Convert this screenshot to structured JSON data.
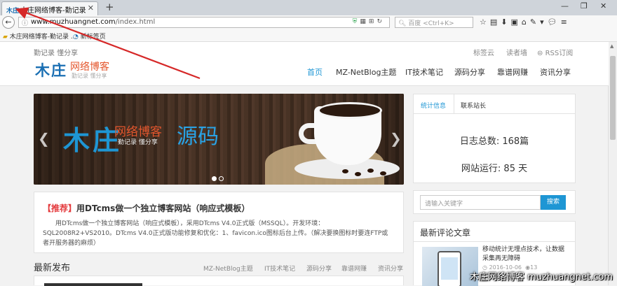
{
  "browser": {
    "tab_title": "木庄网络博客-勤记录 懂分享",
    "tab_favicon_text": "木庄",
    "url_host": "www.muzhuangnet.com",
    "url_path": "/index.html",
    "search_placeholder": "百度 <Ctrl+K>",
    "bookmarks": [
      "木庄网络博客-勤记录 ...",
      "新标签页"
    ]
  },
  "site": {
    "slogan": "勤记录 懂分享",
    "top_links": [
      "标签云",
      "读者墙",
      "RSS订阅"
    ],
    "logo_big": "木庄",
    "logo_name": "网络博客",
    "logo_sub": "勤记录  懂分享",
    "nav": [
      "首页",
      "MZ-NetBlog主题",
      "IT技术笔记",
      "源码分享",
      "靠谱网赚",
      "资讯分享"
    ]
  },
  "slider": {
    "big1": "木庄",
    "mid": "网络博客",
    "sub": "勤记录  懂分享",
    "big2": "源码"
  },
  "sidebar": {
    "tabs": [
      "统计信息",
      "联系站长"
    ],
    "stats": [
      "日志总数: 168篇",
      "网站运行: 85 天"
    ],
    "search_placeholder": "请输入关键字",
    "search_button": "搜索",
    "comments_title": "最新评论文章",
    "comment_text": "移动统计无埋点技术，让数据采集再无障碍",
    "comment_date": "2016-10-06",
    "comment_count": "13"
  },
  "post": {
    "tag": "【推荐】",
    "title": "用DTcms做一个独立博客网站（响应式模板）",
    "body": "用DTcms做一个独立博客网站（响应式模板），采用DTcms V4.0正式版（MSSQL）。开发环境：SQL2008R2+VS2010。DTcms V4.0正式版功能修复和优化：1、favicon.ico图标后台上传。（解决要换图标时要连FTP或者开服务器的麻烦）"
  },
  "latest": {
    "heading": "最新发布",
    "categories": [
      "MZ-NetBlog主题",
      "IT技术笔记",
      "源码分享",
      "靠谱网赚",
      "资讯分享"
    ]
  },
  "watermark": "木庄网络博客 muzhuangnet.com",
  "colors": {
    "accent": "#1e96d4",
    "brand_orange": "#e4572e",
    "recommend_red": "#e4393c",
    "annotation_arrow": "#d62828"
  }
}
